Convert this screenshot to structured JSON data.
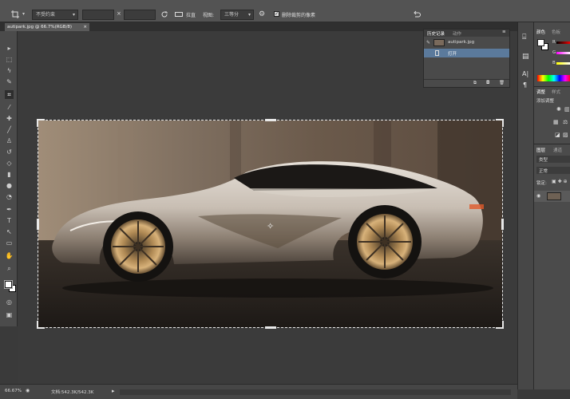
{
  "options_bar": {
    "tool_icon": "crop-tool-icon",
    "ratio_preset": "不受约束",
    "width_value": "",
    "height_value": "",
    "swap_symbol": "×",
    "straighten_label": "拉直",
    "view_label": "视图:",
    "view_value": "三等分",
    "delete_cropped_label": "删除裁剪的像素",
    "reset_icon": "reset-icon"
  },
  "document": {
    "tab_label": "autipark.jpg @ 66.7%(RGB/8)",
    "close_symbol": "×"
  },
  "history_panel": {
    "tabs": [
      "历史记录",
      "动作"
    ],
    "items": [
      {
        "label": "autipark.jpg"
      },
      {
        "label": "打开"
      }
    ]
  },
  "color_panel": {
    "tabs": [
      "颜色",
      "色板"
    ],
    "channels": [
      "R",
      "G",
      "B"
    ]
  },
  "adjustments_panel": {
    "tabs": [
      "调整",
      "样式"
    ],
    "title": "添加调整"
  },
  "layers_panel": {
    "tabs": [
      "图层",
      "通道"
    ],
    "kind_label": "类型",
    "mode_label": "正常",
    "lock_label": "锁定:"
  },
  "status_bar": {
    "zoom": "66.67%",
    "doc_info": "文档:542.3K/542.3K"
  },
  "colors": {
    "chrome": "#535353",
    "panel": "#4b4b4b",
    "canvas": "#3b3b3b",
    "selected_row": "#5b7a9c"
  }
}
